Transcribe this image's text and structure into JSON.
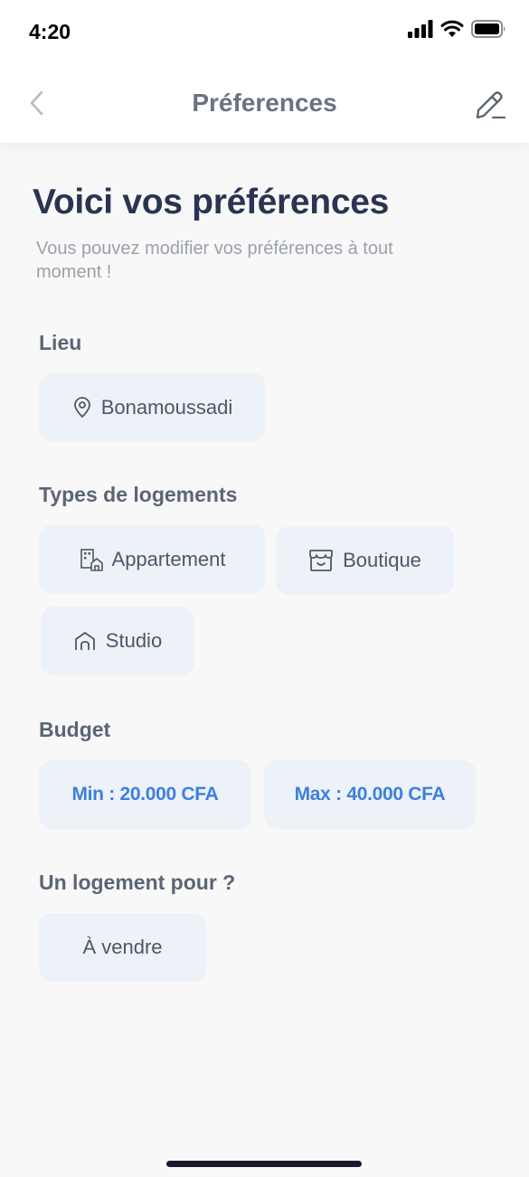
{
  "status_bar": {
    "time": "4:20"
  },
  "header": {
    "title": "Préferences"
  },
  "intro": {
    "title": "Voici vos préférences",
    "subtitle": "Vous pouvez modifier vos préférences à tout moment !"
  },
  "location": {
    "title": "Lieu",
    "value": "Bonamoussadi"
  },
  "housing_types": {
    "title": "Types de logements",
    "items": [
      "Appartement",
      "Boutique",
      "Studio"
    ]
  },
  "budget": {
    "title": "Budget",
    "min": "Min : 20.000 CFA",
    "max": "Max : 40.000 CFA"
  },
  "purpose": {
    "title": "Un logement pour ?",
    "value": "À vendre"
  },
  "colors": {
    "accent": "#3d7fe0",
    "title": "#293451",
    "chip_bg": "#edf2f8"
  }
}
